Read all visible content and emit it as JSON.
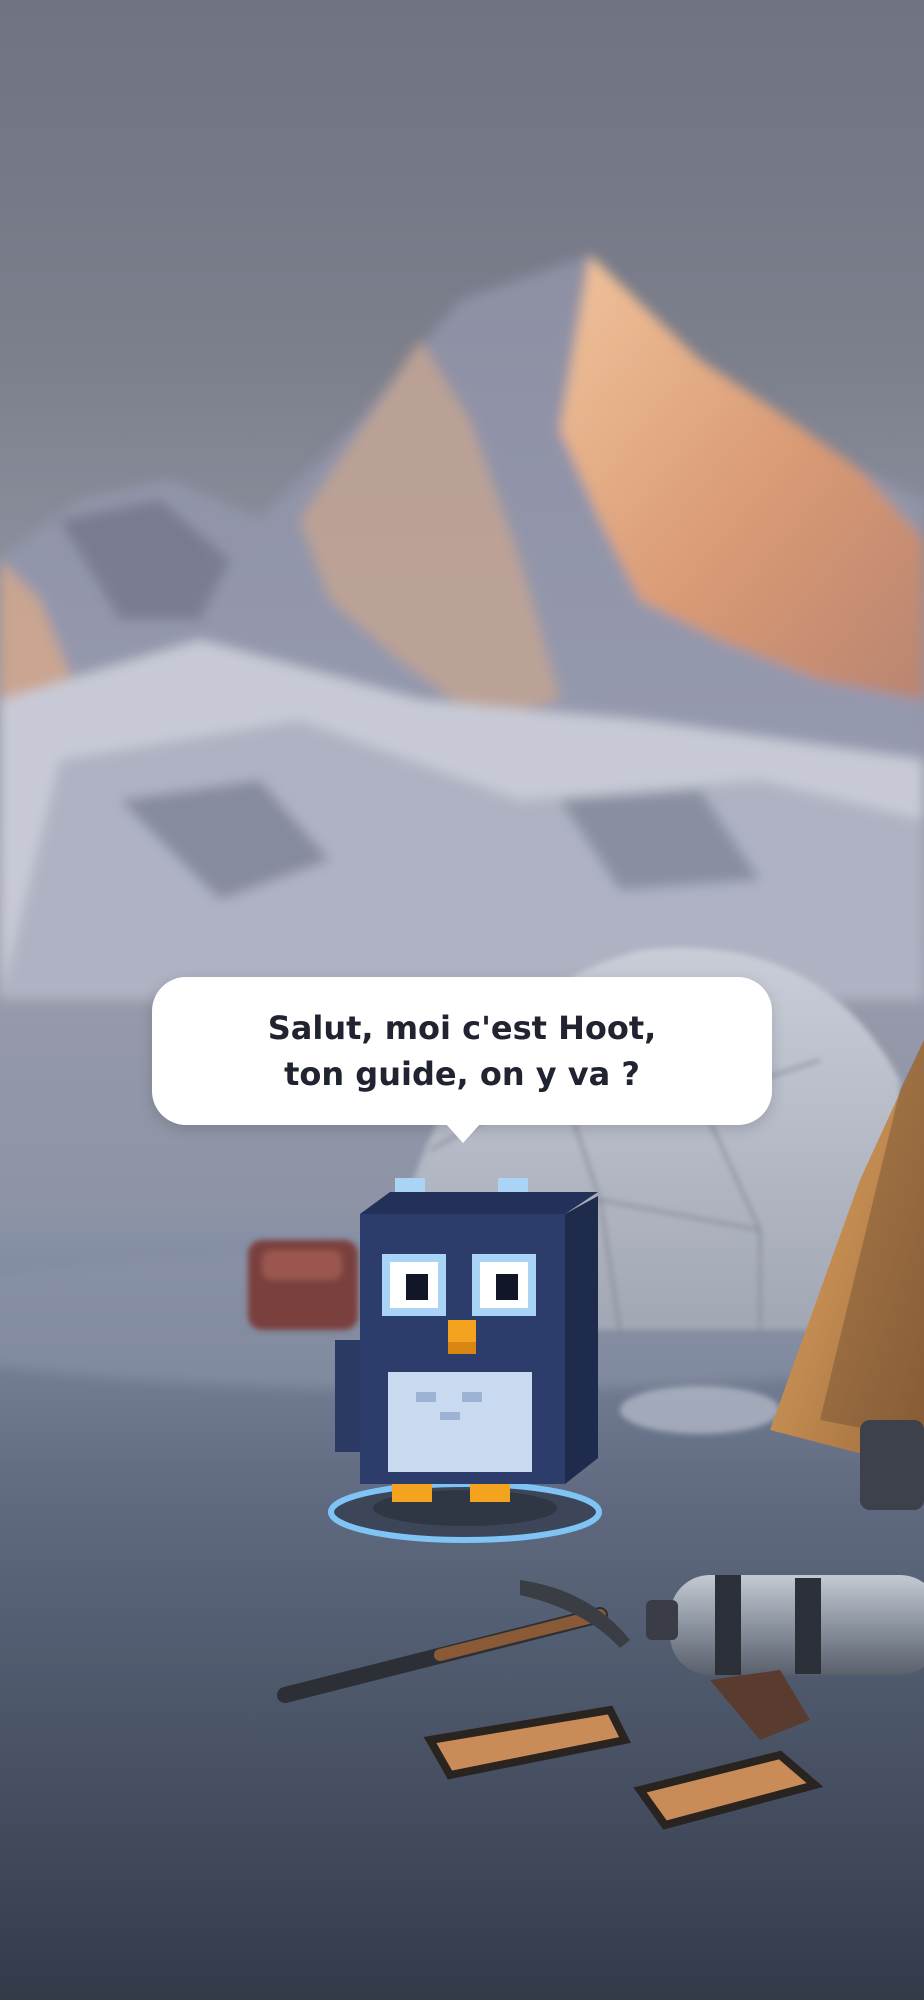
{
  "scene": {
    "name": "base-camp",
    "colors": {
      "sky": "#7c7f8c",
      "snow": "#d9dbe4",
      "sunlit_rock": "#e2b08a",
      "tent_orange": "#c98d4c",
      "character_body": "#2c3d6b",
      "ring_glow": "#7fc4f5"
    }
  },
  "dialog": {
    "line1": "Salut, moi c'est Hoot,",
    "line2": "ton guide, on y va ?"
  },
  "character": {
    "icon": "pixel-owl-guide-icon"
  }
}
